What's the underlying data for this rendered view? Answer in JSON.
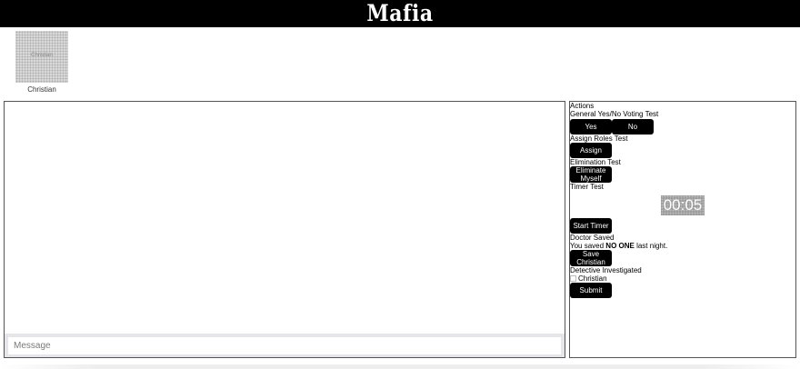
{
  "header": {
    "logo_text": "Mafia"
  },
  "player": {
    "avatar_label": "Christian",
    "name": "Christian"
  },
  "chat": {
    "input_placeholder": "Message",
    "input_value": ""
  },
  "actions": {
    "title": "Actions",
    "voting": {
      "label": "General Yes/No Voting Test",
      "yes": "Yes",
      "no": "No"
    },
    "roles": {
      "label": "Assign Roles Test",
      "button": "Assign Roles"
    },
    "elimination": {
      "label": "Elimination Test",
      "button_line1": "Eliminate",
      "button_line2": "Myself"
    },
    "timer": {
      "label": "Timer Test",
      "display": "00:05",
      "button": "Start Timer"
    },
    "doctor": {
      "label": "Doctor Saved",
      "text_before": "You saved ",
      "saved_name": "NO ONE",
      "text_after": " last night.",
      "button_line1": "Save",
      "button_line2": "Christian"
    },
    "detective": {
      "label": "Detective Investigated",
      "option": "Christian",
      "submit": "Submit"
    }
  },
  "colors": {
    "header_bg": "#000000",
    "button_bg": "#000000",
    "button_text": "#ffffff",
    "chat_bar_bg": "#e6e6ea"
  }
}
